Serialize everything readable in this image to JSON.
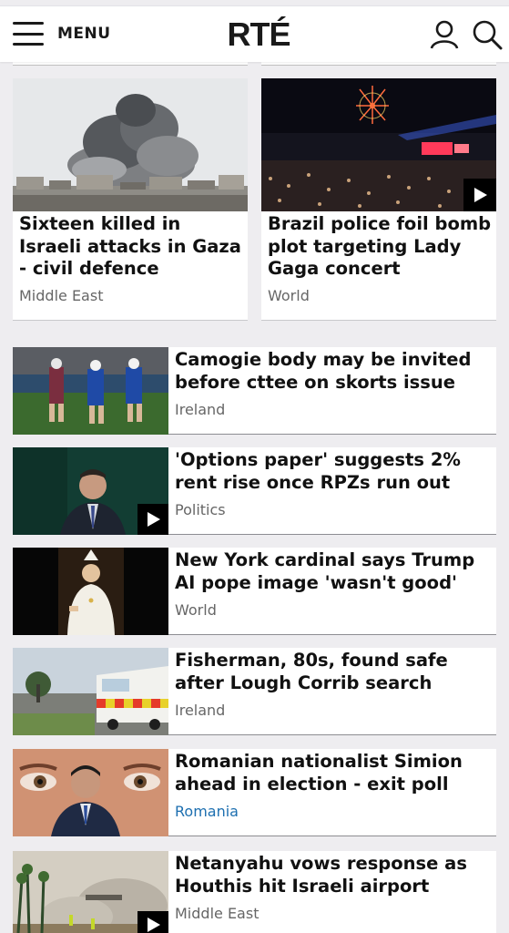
{
  "header": {
    "menu_label": "MENU",
    "logo_text": "RTÉ",
    "icons": [
      "hamburger-icon",
      "account-icon",
      "search-icon"
    ]
  },
  "featured": [
    {
      "title": "Sixteen killed in Israeli attacks in Gaza - civil defence",
      "category": "Middle East",
      "video": false
    },
    {
      "title": "Brazil police foil bomb plot targeting Lady Gaga concert",
      "category": "World",
      "video": true
    }
  ],
  "stories": [
    {
      "title": "Camogie body may be invited before cttee on skorts issue",
      "category": "Ireland",
      "video": false
    },
    {
      "title": "'Options paper' suggests 2% rent rise once RPZs run out",
      "category": "Politics",
      "video": true
    },
    {
      "title": "New York cardinal says Trump AI pope image 'wasn't good'",
      "category": "World",
      "video": false
    },
    {
      "title": "Fisherman, 80s, found safe after Lough Corrib search",
      "category": "Ireland",
      "video": false
    },
    {
      "title": "Romanian nationalist Simion ahead in election - exit poll",
      "category": "Romania",
      "video": false
    },
    {
      "title": "Netanyahu vows response as Houthis hit Israeli airport",
      "category": "Middle East",
      "video": true
    }
  ],
  "colors": {
    "link_blue": "#1d6fb0",
    "text_dark": "#111111",
    "category_grey": "#666666",
    "page_bg": "#eeedf0"
  }
}
